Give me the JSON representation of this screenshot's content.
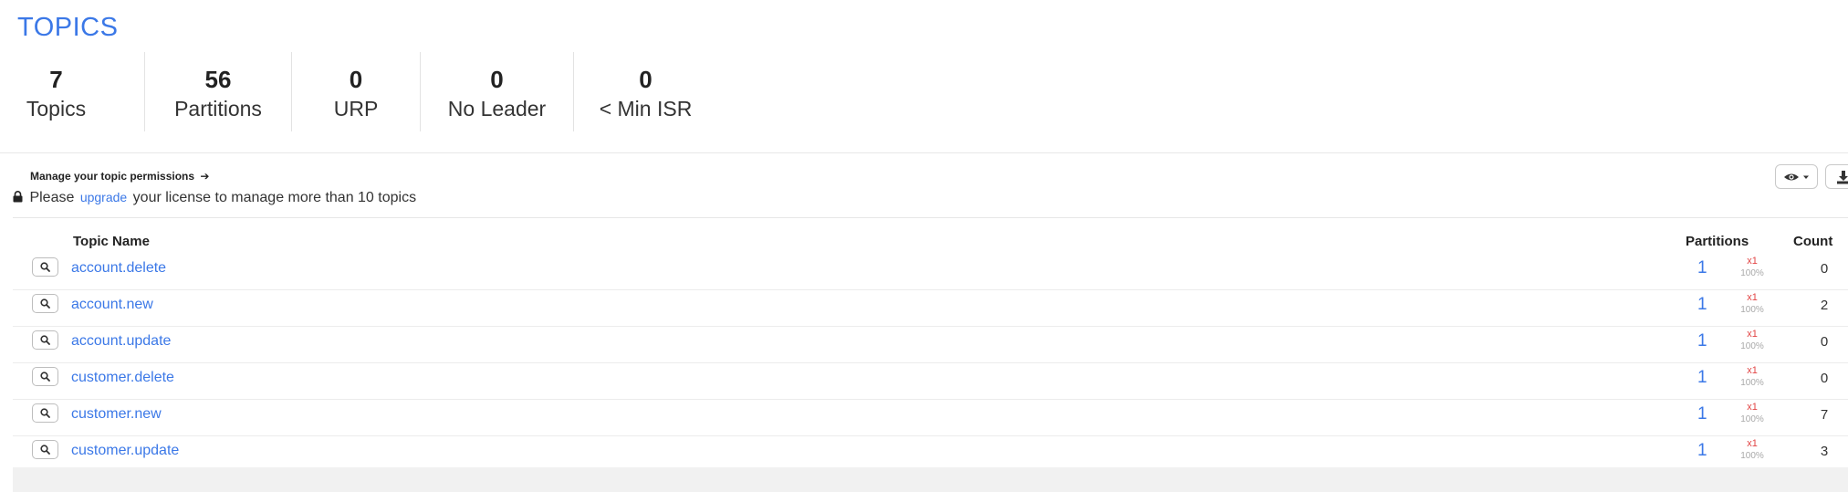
{
  "header": {
    "title": "TOPICS"
  },
  "stats": [
    {
      "value": "7",
      "label": "Topics"
    },
    {
      "value": "56",
      "label": "Partitions"
    },
    {
      "value": "0",
      "label": "URP"
    },
    {
      "value": "0",
      "label": "No Leader"
    },
    {
      "value": "0",
      "label": "< Min ISR"
    }
  ],
  "panel": {
    "permissions_link": "Manage your topic permissions",
    "notice_prefix": "Please",
    "notice_link": "upgrade",
    "notice_suffix": "your license to manage more than 10 topics"
  },
  "table": {
    "columns": {
      "name": "Topic Name",
      "partitions": "Partitions",
      "count": "Count"
    },
    "rows": [
      {
        "name": "account.delete",
        "partitions": "1",
        "replication": "x1",
        "percent": "100%",
        "count": "0"
      },
      {
        "name": "account.new",
        "partitions": "1",
        "replication": "x1",
        "percent": "100%",
        "count": "2"
      },
      {
        "name": "account.update",
        "partitions": "1",
        "replication": "x1",
        "percent": "100%",
        "count": "0"
      },
      {
        "name": "customer.delete",
        "partitions": "1",
        "replication": "x1",
        "percent": "100%",
        "count": "0"
      },
      {
        "name": "customer.new",
        "partitions": "1",
        "replication": "x1",
        "percent": "100%",
        "count": "7"
      },
      {
        "name": "customer.update",
        "partitions": "1",
        "replication": "x1",
        "percent": "100%",
        "count": "3"
      }
    ]
  },
  "icons": {
    "search": "search-icon",
    "eye": "eye-icon",
    "download": "download-icon",
    "lock": "lock-icon",
    "arrow": "arrow-right-icon"
  },
  "colors": {
    "accent": "#3b78e7",
    "replication": "#e24444",
    "muted": "#a9a9a9"
  }
}
